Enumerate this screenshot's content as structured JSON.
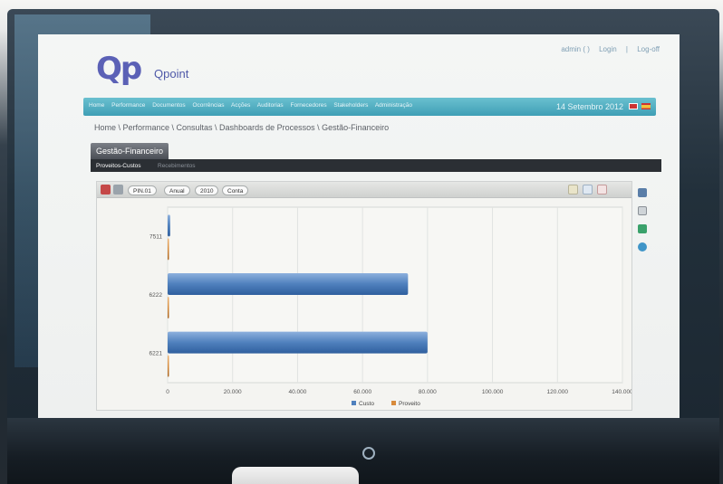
{
  "app": {
    "logo_mark": "Qp",
    "name": "Qpoint"
  },
  "top_links": [
    "admin ( )",
    "Login",
    "|",
    "Log-off"
  ],
  "nav": {
    "items": [
      "Home",
      "Performance",
      "Documentos",
      "Ocorrências",
      "Acções",
      "Auditorias",
      "Fornecedores",
      "Stakeholders",
      "Administração"
    ],
    "date": "14 Setembro 2012"
  },
  "breadcrumb": "Home \\ Performance \\ Consultas \\ Dashboards de Processos \\ Gestão-Financeiro",
  "section_title": "Gestão-Financeiro",
  "subtabs": {
    "active": "Proveitos-Custos",
    "inactive": "Recebimentos"
  },
  "toolbar": {
    "crumbs": [
      "PIN.01",
      "Anual",
      "2010",
      "Conta"
    ]
  },
  "colors": {
    "custo": "#4f80bd",
    "proveito": "#d88b3b",
    "nav": "#4fb0c4",
    "logo": "#5b61b6"
  },
  "chart_data": {
    "type": "bar",
    "orientation": "horizontal",
    "categories": [
      "7511",
      "6222",
      "6221"
    ],
    "series": [
      {
        "name": "Custo",
        "values": [
          800,
          74000,
          80000
        ]
      },
      {
        "name": "Proveito",
        "values": [
          0,
          0,
          0
        ]
      }
    ],
    "x_ticks": [
      "0",
      "20.000",
      "40.000",
      "60.000",
      "80.000",
      "100.000",
      "120.000",
      "140.000"
    ],
    "xlim": [
      0,
      140000
    ],
    "grid": true,
    "legend_position": "bottom"
  }
}
